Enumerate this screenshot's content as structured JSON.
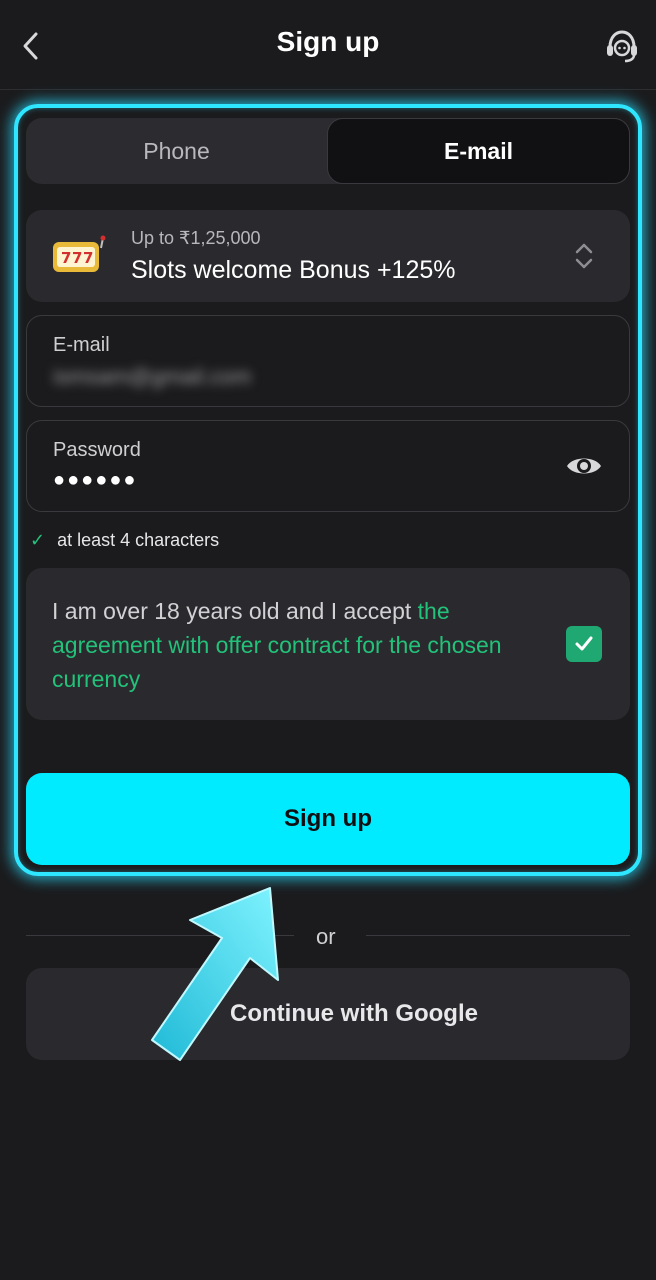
{
  "header": {
    "title": "Sign up",
    "back_icon": "chevron-left-icon",
    "support_icon": "headset-icon"
  },
  "tabs": [
    {
      "label": "Phone",
      "active": false
    },
    {
      "label": "E-mail",
      "active": true
    }
  ],
  "bonus": {
    "icon": "slot-machine-icon",
    "subtitle": "Up to ₹1,25,000",
    "title": "Slots welcome Bonus +125%"
  },
  "email_field": {
    "label": "E-mail",
    "value": "ismsam@gmail.com"
  },
  "password_field": {
    "label": "Password",
    "value": "●●●●●●"
  },
  "password_hint": "at least 4 characters",
  "agreement": {
    "text": "I am over 18 years old and I accept ",
    "link": "the agreement with offer contract for the chosen currency",
    "checked": true
  },
  "signup_button": "Sign up",
  "divider_text": "or",
  "google_button": "Continue with Google",
  "colors": {
    "accent": "#00ebff",
    "glow": "#2ee6ff",
    "success": "#22c27a",
    "background": "#1b1b1d"
  }
}
